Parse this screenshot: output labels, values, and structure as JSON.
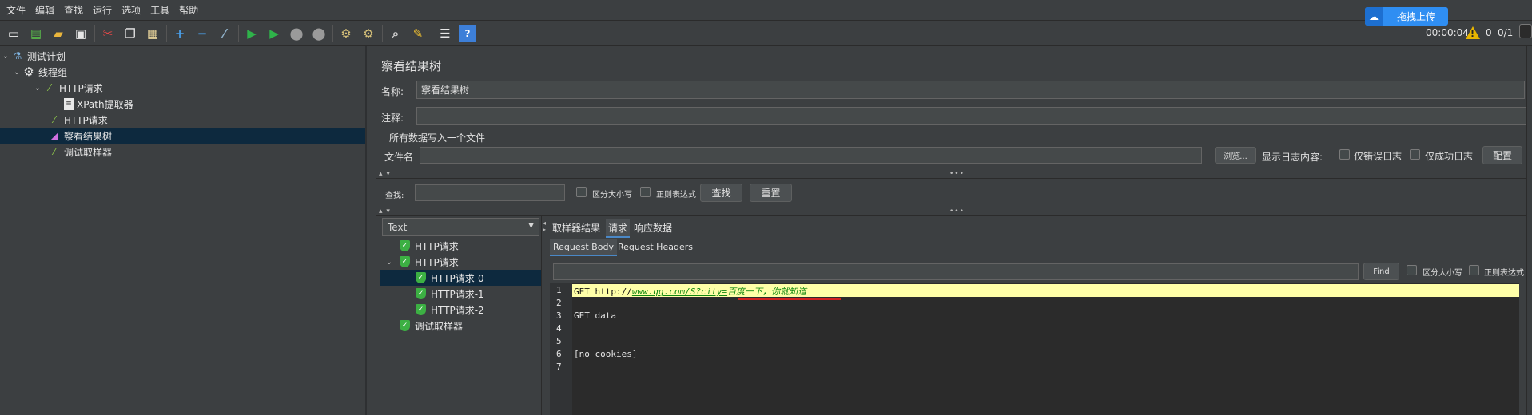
{
  "menu": [
    "文件",
    "编辑",
    "查找",
    "运行",
    "选项",
    "工具",
    "帮助"
  ],
  "toolbar": {
    "icons": [
      "new-icon",
      "templates-icon",
      "open-icon",
      "save-icon",
      "cut-icon",
      "copy-icon",
      "paste-icon",
      "expand-icon",
      "collapse-icon",
      "toggle-icon",
      "start-icon",
      "start-no-pause-icon",
      "stop-icon",
      "shutdown-icon",
      "clear-icon",
      "clear-all-icon",
      "search-icon",
      "reset-search-icon",
      "function-helper-icon",
      "help-icon"
    ],
    "upload_label": "拖拽上传",
    "timer": "00:00:04",
    "warn_count": "0",
    "threads": "0/1"
  },
  "tree": {
    "items": [
      {
        "label": "测试计划",
        "icon": "flask-icon",
        "level": 0,
        "expanded": true
      },
      {
        "label": "线程组",
        "icon": "gear-icon",
        "level": 1,
        "expanded": true
      },
      {
        "label": "HTTP请求",
        "icon": "pipette-icon",
        "level": 2,
        "expanded": true
      },
      {
        "label": "XPath提取器",
        "icon": "document-icon",
        "level": 3
      },
      {
        "label": "HTTP请求",
        "icon": "pipette-icon",
        "level": 2
      },
      {
        "label": "察看结果树",
        "icon": "chart-icon",
        "level": 2,
        "selected": true
      },
      {
        "label": "调试取样器",
        "icon": "pipette-icon",
        "level": 2
      }
    ]
  },
  "panel": {
    "title": "察看结果树",
    "name_label": "名称:",
    "name_value": "察看结果树",
    "comment_label": "注释:",
    "comment_value": "",
    "file_section": "所有数据写入一个文件",
    "filename_label": "文件名",
    "filename_value": "",
    "browse_label": "浏览...",
    "log_label": "显示日志内容:",
    "errors_only": "仅错误日志",
    "success_only": "仅成功日志",
    "config_label": "配置",
    "search_label": "查找:",
    "search_value": "",
    "case_label": "区分大小写",
    "regex_label": "正则表达式",
    "find_label": "查找",
    "reset_label": "重置"
  },
  "results": {
    "renderer": "Text",
    "items": [
      {
        "label": "HTTP请求",
        "level": 0
      },
      {
        "label": "HTTP请求",
        "level": 0,
        "expanded": true
      },
      {
        "label": "HTTP请求-0",
        "level": 1,
        "selected": true
      },
      {
        "label": "HTTP请求-1",
        "level": 1
      },
      {
        "label": "HTTP请求-2",
        "level": 1
      },
      {
        "label": "调试取样器",
        "level": 0
      }
    ],
    "tabs": [
      "取样器结果",
      "请求",
      "响应数据"
    ],
    "active_tab": "请求",
    "subtabs": [
      "Request Body",
      "Request Headers"
    ],
    "active_subtab": "Request Body",
    "find_button": "Find",
    "case_label": "区分大小写",
    "regex_label": "正则表达式"
  },
  "editor": {
    "line_numbers": [
      "1",
      "2",
      "3",
      "4",
      "5",
      "6",
      "7"
    ],
    "line1_prefix": "GET http://",
    "line1_url": "www.qq.com/S?city=",
    "line1_param": "百度一下，你就知道",
    "line3": "GET data",
    "line6": "[no cookies]"
  },
  "colors": {
    "accent": "#4a88c7",
    "selection": "#0d293e",
    "highlight_line": "#ffffa8",
    "underline_red": "#d22020",
    "success_green": "#3cb043"
  }
}
